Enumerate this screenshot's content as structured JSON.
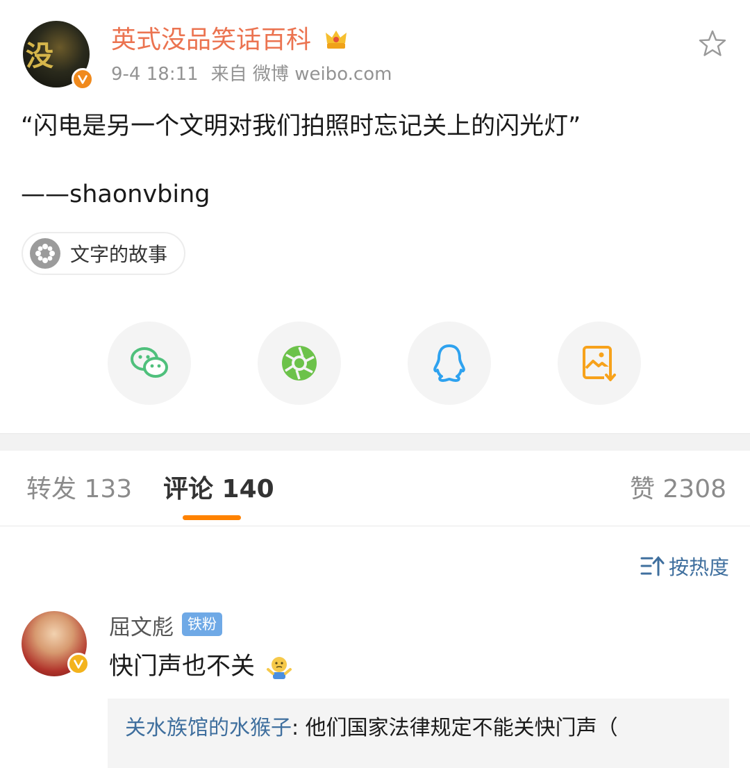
{
  "post": {
    "author": "英式没品笑话百科",
    "timestamp": "9-4 18:11",
    "source": "来自 微博 weibo.com",
    "text_line1": "“闪电是另一个文明对我们拍照时忘记关上的闪光灯”",
    "text_line2": "——shaonvbing",
    "topic": "文字的故事"
  },
  "avatar_text": "没",
  "share": [
    "wechat-icon",
    "moments-icon",
    "qq-icon",
    "save-image-icon"
  ],
  "tabs": {
    "repost": "转发 133",
    "comment": "评论 140",
    "like": "赞 2308"
  },
  "sort_label": "按热度",
  "comment": {
    "user": "屈文彪",
    "badge": "铁粉",
    "text": "快门声也不关",
    "reply_user": "关水族馆的水猴子",
    "reply_text": ": 他们国家法律规定不能关快门声（"
  },
  "colors": {
    "accent": "#ff8200",
    "username": "#eb7350",
    "link": "#3f6f9e",
    "badge": "#6fa9e6",
    "wechat": "#4fc07c",
    "moments": "#6cc24a",
    "qq": "#2ea2ef",
    "save": "#f7a21b"
  }
}
